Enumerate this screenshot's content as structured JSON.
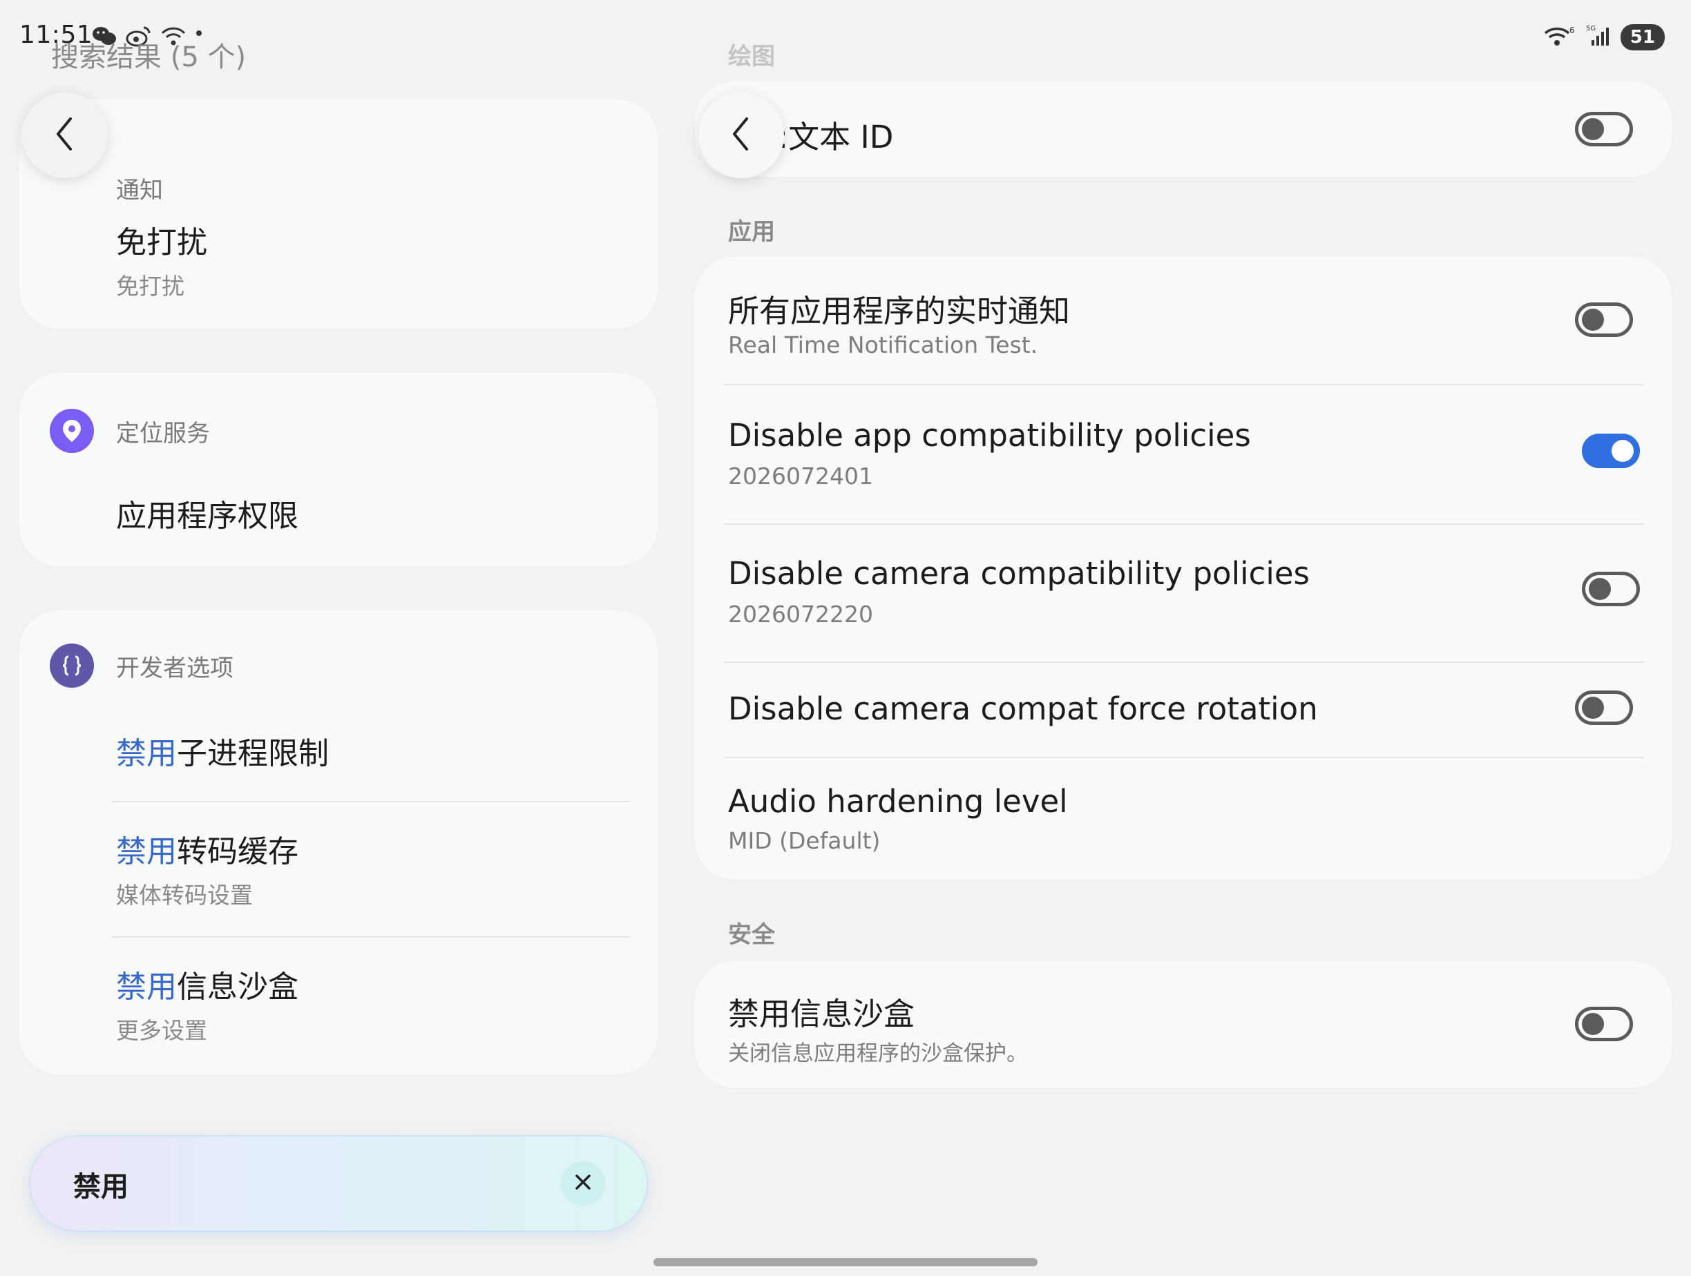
{
  "status_bar": {
    "time": "11:51",
    "left_icons": [
      "wechat-icon",
      "weibo-icon",
      "wifi-icon",
      "dot-icon"
    ],
    "right_icons": [
      "wifi6-icon",
      "signal-5g-icon"
    ],
    "battery": "51"
  },
  "left_pane": {
    "title": "搜索结果 (5 个)",
    "groups": [
      {
        "category": "通知",
        "icon": "bell-icon",
        "items": [
          {
            "title_hl": "",
            "title_rest": "免打扰",
            "subtitle": "免打扰"
          }
        ]
      },
      {
        "category": "定位服务",
        "icon": "location-pin-icon",
        "icon_color": "#7b5cf5",
        "items": [
          {
            "title_hl": "",
            "title_rest": "应用程序权限",
            "subtitle": ""
          }
        ]
      },
      {
        "category": "开发者选项",
        "icon": "braces-icon",
        "icon_color": "#5f58a8",
        "items": [
          {
            "title_hl": "禁用",
            "title_rest": "子进程限制",
            "subtitle": ""
          },
          {
            "title_hl": "禁用",
            "title_rest": "转码缓存",
            "subtitle": "媒体转码设置"
          },
          {
            "title_hl": "禁用",
            "title_rest": "信息沙盒",
            "subtitle": "更多设置"
          }
        ]
      }
    ],
    "search": {
      "query": "禁用",
      "clear_icon": "close-icon"
    }
  },
  "right_pane": {
    "sections": [
      {
        "label": "绘图",
        "rows": [
          {
            "title": "显示文本 ID",
            "visible_title": ":文本 ID",
            "toggle": false
          }
        ]
      },
      {
        "label": "应用",
        "rows": [
          {
            "title": "所有应用程序的实时通知",
            "subtitle": "Real Time Notification Test.",
            "toggle": false
          },
          {
            "title": "Disable app compatibility policies",
            "subtitle": "2026072401",
            "toggle": true
          },
          {
            "title": "Disable camera compatibility policies",
            "subtitle": "2026072220",
            "toggle": false
          },
          {
            "title": "Disable camera compat force rotation",
            "subtitle": "",
            "toggle": false
          },
          {
            "title": "Audio hardening level",
            "subtitle": "MID (Default)"
          }
        ]
      },
      {
        "label": "安全",
        "rows": [
          {
            "title": "禁用信息沙盒",
            "subtitle": "关闭信息应用程序的沙盒保护。",
            "toggle": false
          }
        ]
      }
    ]
  },
  "colors": {
    "accent": "#2f6fe0",
    "highlight_text": "#3767c9",
    "background": "#f1f2f2",
    "card": "#f8f9f9"
  }
}
